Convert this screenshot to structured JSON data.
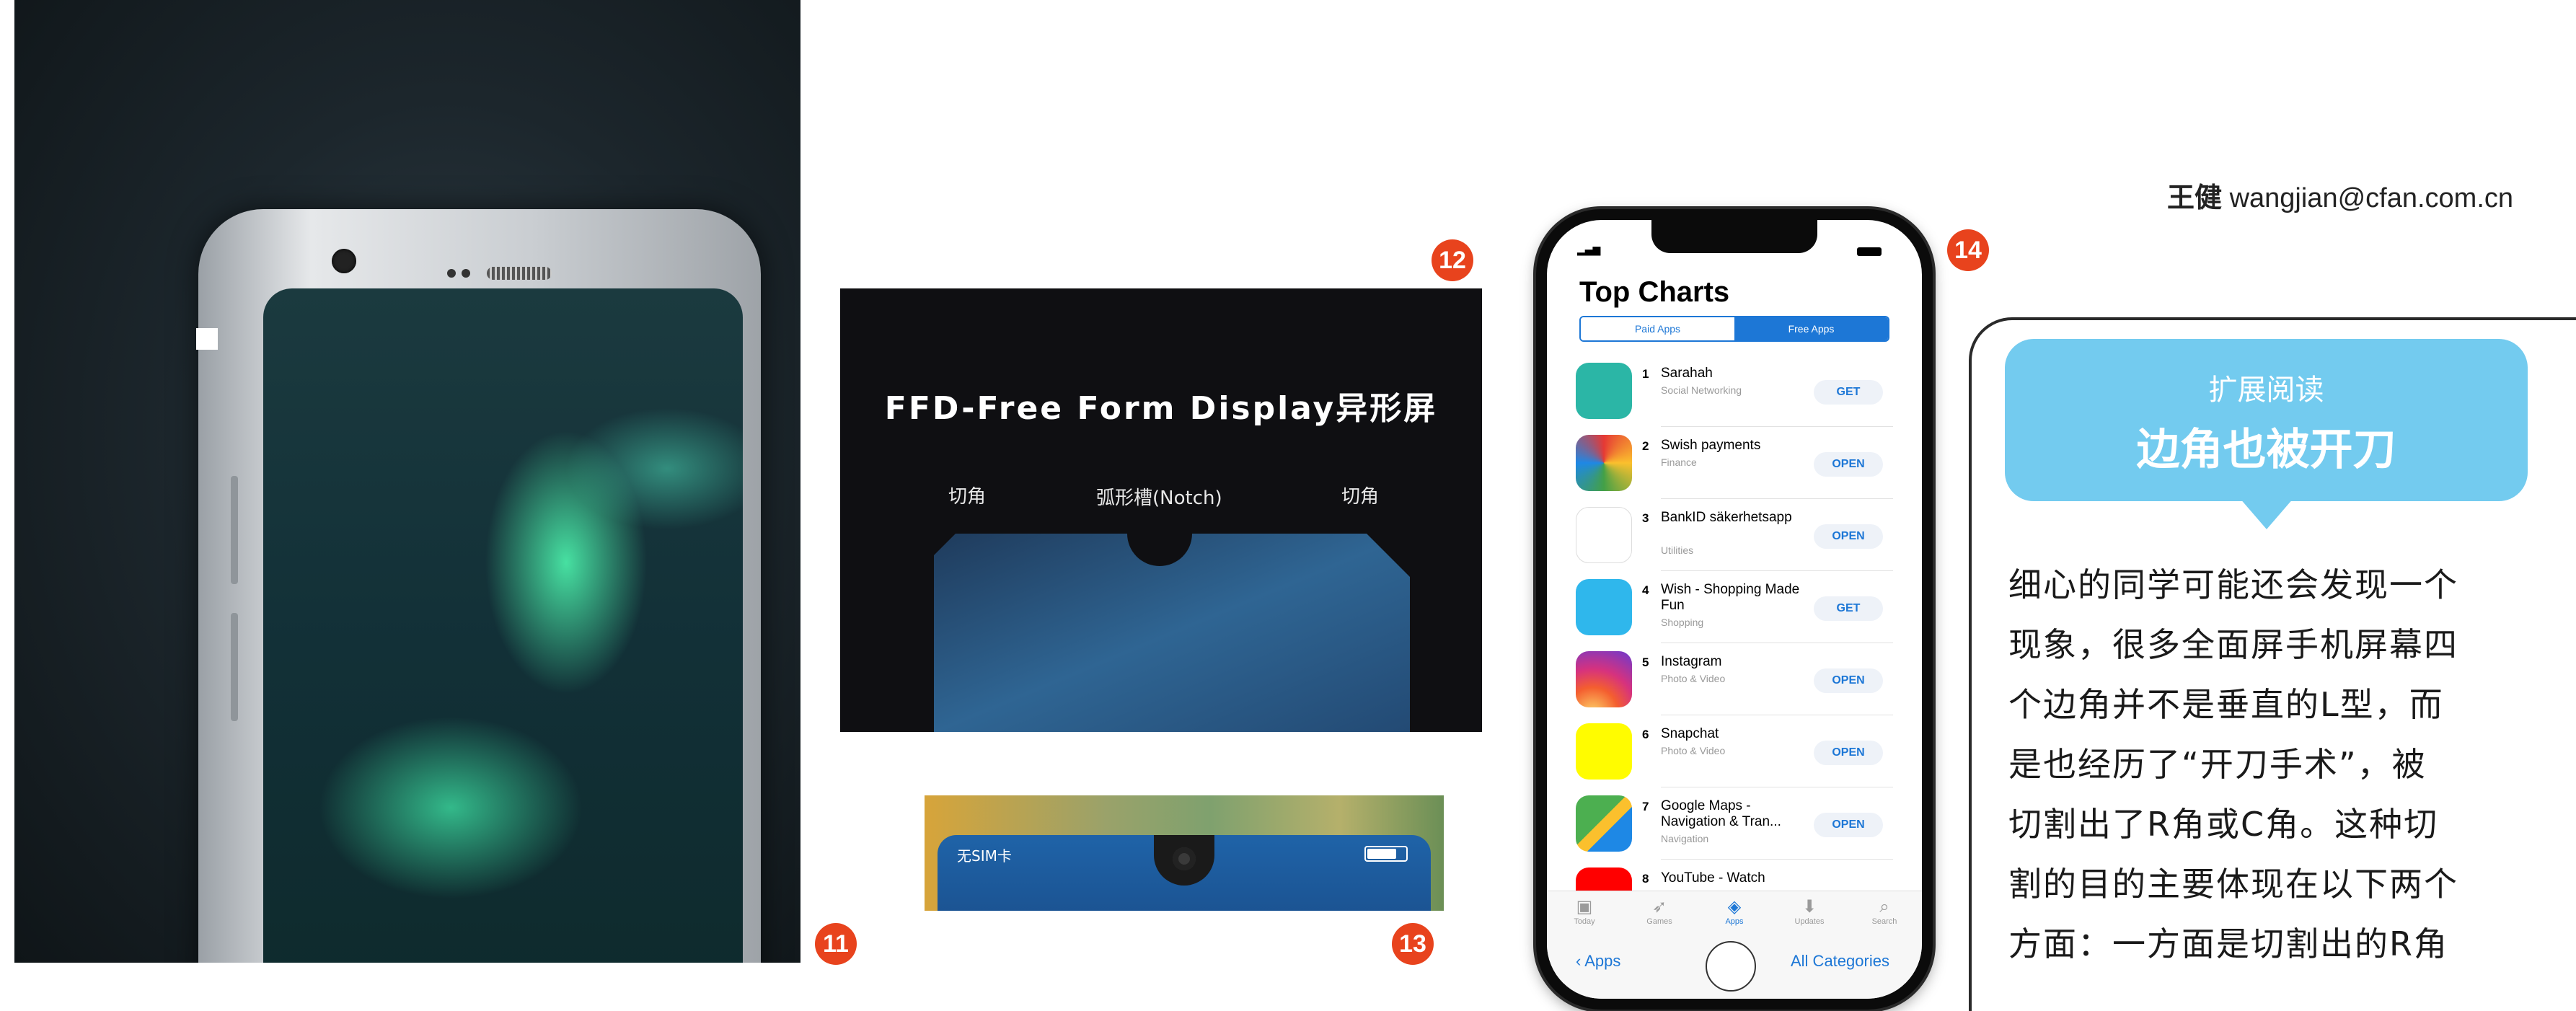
{
  "figures": {
    "fig11": {
      "number": "11"
    },
    "fig12": {
      "number": "12",
      "title": "FFD-Free Form Display异形屏",
      "label_left": "切角",
      "label_center": "弧形槽(Notch)",
      "label_right": "切角"
    },
    "fig13": {
      "number": "13",
      "status_left": "无SIM卡"
    },
    "fig14": {
      "number": "14",
      "page_title": "Top Charts",
      "segment_paid": "Paid Apps",
      "segment_free": "Free Apps",
      "apps": [
        {
          "rank": "1",
          "name": "Sarahah",
          "category": "Social Networking",
          "action": "GET",
          "icon_color": "#2bb6a6"
        },
        {
          "rank": "2",
          "name": "Swish payments",
          "category": "Finance",
          "action": "OPEN",
          "icon_color": "#f2f2f2"
        },
        {
          "rank": "3",
          "name": "BankID säkerhetsapp",
          "category": "Utilities",
          "action": "OPEN",
          "icon_color": "#ffffff"
        },
        {
          "rank": "4",
          "name": "Wish - Shopping Made Fun",
          "category": "Shopping",
          "action": "GET",
          "icon_color": "#2fb7ec"
        },
        {
          "rank": "5",
          "name": "Instagram",
          "category": "Photo & Video",
          "action": "OPEN",
          "icon_color": "#d6327e"
        },
        {
          "rank": "6",
          "name": "Snapchat",
          "category": "Photo & Video",
          "action": "OPEN",
          "icon_color": "#fffc00"
        },
        {
          "rank": "7",
          "name": "Google Maps - Navigation & Tran...",
          "category": "Navigation",
          "action": "OPEN",
          "icon_color": "#4caf50"
        },
        {
          "rank": "8",
          "name": "YouTube - Watch",
          "category": "",
          "action": "",
          "icon_color": "#ff0000"
        }
      ],
      "tabs": [
        {
          "label": "Today",
          "icon": "today-icon"
        },
        {
          "label": "Games",
          "icon": "rocket-icon"
        },
        {
          "label": "Apps",
          "icon": "layers-icon"
        },
        {
          "label": "Updates",
          "icon": "download-icon"
        },
        {
          "label": "Search",
          "icon": "search-icon"
        }
      ],
      "back_label": "Apps",
      "all_categories": "All Categories"
    }
  },
  "author": {
    "name": "王健",
    "email": "wangjian@cfan.com.cn"
  },
  "sidebar": {
    "subtitle": "扩展阅读",
    "title": "边角也被开刀",
    "lines": [
      "细心的同学可能还会发现一个",
      "现象，很多全面屏手机屏幕四",
      "个边角并不是垂直的L型，而",
      "是也经历了“开刀手术”，被",
      "切割出了R角或C角。这种切",
      "割的目的主要体现在以下两个",
      "方面：一方面是切割出的R角"
    ]
  },
  "colors": {
    "badge": "#e8431d",
    "accent_blue": "#1d77d6",
    "bubble": "#73cbef"
  }
}
